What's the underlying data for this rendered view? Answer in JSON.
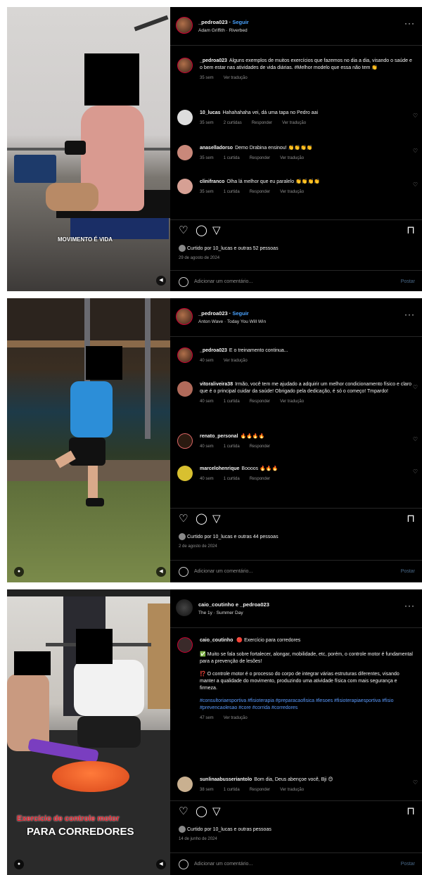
{
  "posts": [
    {
      "username": "_pedroa023",
      "follow_label": "Seguir",
      "audio": "Adam Griffith · Riverbed",
      "overlay_text": "MOVIMENTO É VIDA",
      "caption": {
        "user": "_pedroa023",
        "text": "Alguns exemplos de muitos exercícios que fazemos no dia a dia, visando o saúde e o bem estar nas atividades de vida diárias. #Melhor modelo que essa não tem 👏",
        "time": "35 sem",
        "see_translation": "Ver tradução"
      },
      "comments": [
        {
          "user": "10_lucas",
          "text": "Hahahahaha vei, dá uma tapa no Pedro aai",
          "time": "35 sem",
          "likes": "2 curtidas",
          "reply": "Responder",
          "translate": "Ver tradução"
        },
        {
          "user": "anaselladorso",
          "text": "Demo Drabina ensinou! 👏👏👏👏",
          "time": "35 sem",
          "likes": "1 curtida",
          "reply": "Responder",
          "translate": "Ver tradução"
        },
        {
          "user": "clinifranco",
          "text": "Olha lá melhor que eu paralelo 👏👏👏👏",
          "time": "35 sem",
          "likes": "1 curtida",
          "reply": "Responder",
          "translate": "Ver tradução"
        }
      ],
      "liked_by": "Curtido por 10_lucas e outras 52 pessoas",
      "date": "29 de agosto de 2024",
      "add_comment_placeholder": "Adicionar um comentário...",
      "publish_label": "Postar"
    },
    {
      "username": "_pedroa023",
      "follow_label": "Seguir",
      "audio": "Anton Wave · Today You Will Win",
      "caption": {
        "user": "_pedroa023",
        "text": "E o treinamento continua...",
        "time": "40 sem",
        "see_translation": "Ver tradução"
      },
      "comments": [
        {
          "user": "vitoraliveira38",
          "text": "Irmão, você tem me ajudado a adquirir um melhor condicionamento físico e claro que é o principal cuidar da saúde! Obrigado pela dedicação, é só o começo! Tmpardo!",
          "time": "40 sem",
          "likes": "1 curtida",
          "reply": "Responder",
          "translate": "Ver tradução"
        },
        {
          "user": "renato_personal",
          "text": "🔥🔥🔥🔥",
          "time": "40 sem",
          "likes": "1 curtida",
          "reply": "Responder",
          "translate": ""
        },
        {
          "user": "marcelohenrique",
          "text": "Boooos 🔥🔥🔥",
          "time": "40 sem",
          "likes": "1 curtida",
          "reply": "Responder",
          "translate": ""
        }
      ],
      "liked_by": "Curtido por 10_lucas e outras 44 pessoas",
      "date": "2 de agosto de 2024",
      "add_comment_placeholder": "Adicionar um comentário...",
      "publish_label": "Postar"
    },
    {
      "username": "caio_coutinho e _pedroa023",
      "audio": "The 1y · Summer Day",
      "overlay_title": "Exercício de controle motor",
      "overlay_sub": "PARA CORREDORES",
      "caption": {
        "user": "caio_coutinho",
        "text1": "🔴 Exercício para corredores",
        "text2": "✅ Muito se fala sobre fortalecer, alongar, mobilidade, etc, porém, o controle motor é fundamental para a prevenção de lesões!",
        "text3": "⁉️ O controle motor é o processo do corpo de integrar várias estruturas diferentes, visando manter a qualidade do movimento, produzindo uma atividade física com mais segurança e firmeza.",
        "hashtags": "#consultoriaesportiva #fisioterapia #preparacaofisica #lesoes #fisioterapiaesportiva #fisio #prevencaolesao #core #corrida #corredores",
        "time": "47 sem",
        "see_translation": "Ver tradução"
      },
      "comments": [
        {
          "user": "sunlinaabusseriantolo",
          "text": "Bom dia, Deus abençoe você, Bji 😊",
          "time": "38 sem",
          "likes": "1 curtida",
          "reply": "Responder",
          "translate": "Ver tradução"
        }
      ],
      "liked_by": "Curtido por 10_lucas e outras pessoas",
      "date": "14 de junho de 2024",
      "add_comment_placeholder": "Adicionar um comentário...",
      "publish_label": "Postar"
    }
  ]
}
